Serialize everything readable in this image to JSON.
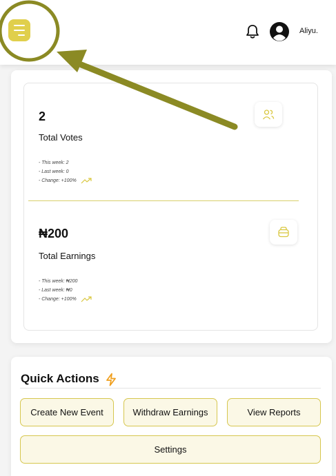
{
  "header": {
    "user_name": "Aliyu.",
    "icons": [
      "menu-icon",
      "bell-icon",
      "user-avatar-icon"
    ],
    "accent_color": "#e0cf4c",
    "annotation_color": "#8b8a24"
  },
  "stats": {
    "votes": {
      "value": "2",
      "label": "Total Votes",
      "this_week": "- This week: 2",
      "last_week": "- Last week: 0",
      "change": "- Change: +100%",
      "icon": "users-icon"
    },
    "earnings": {
      "value": "₦200",
      "label": "Total Earnings",
      "this_week": "- This week: ₦200",
      "last_week": "- Last week: ₦0",
      "change": "- Change: +100%",
      "icon": "wallet-icon"
    }
  },
  "quick_actions": {
    "title": "Quick Actions",
    "icon": "bolt-icon",
    "buttons": {
      "create_event": "Create New Event",
      "withdraw": "Withdraw Earnings",
      "reports": "View Reports",
      "settings": "Settings"
    }
  }
}
